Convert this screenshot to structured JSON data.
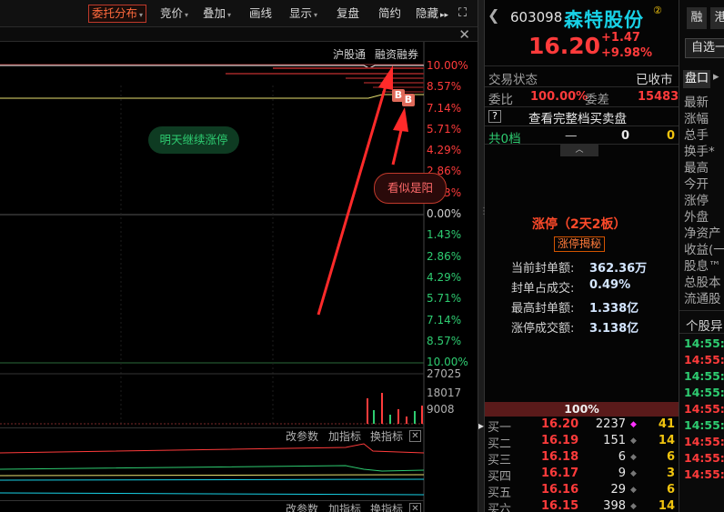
{
  "toolbar": {
    "items": [
      "委托分布",
      "竞价",
      "叠加",
      "画线",
      "显示",
      "复盘",
      "简约",
      "隐藏"
    ],
    "caret": "▾",
    "hide_arrow": "▸▸",
    "expand_icon": "⛶",
    "close_icon": "✕"
  },
  "chart": {
    "hud_links": [
      "沪股通",
      "融资融券"
    ],
    "pct_up": [
      "10.00%",
      "8.57%",
      "7.14%",
      "5.71%",
      "4.29%",
      "2.86%",
      "1.43%"
    ],
    "pct_zero": "0.00%",
    "pct_down": [
      "1.43%",
      "2.86%",
      "4.29%",
      "5.71%",
      "7.14%",
      "8.57%",
      "10.00%"
    ],
    "note1": "明天继续涨停",
    "note2": "看似是阳",
    "b_mark": "B",
    "volume_labels": [
      "27025",
      "18017",
      "9008"
    ],
    "indicator_links": [
      "改参数",
      "加指标",
      "换指标"
    ],
    "indicator_close": "✕",
    "colors": {
      "up": "#ff3b3b",
      "down": "#2ecc71",
      "price_line": "#e8e070",
      "arrow": "#ff2a2a"
    }
  },
  "quote": {
    "code": "603098",
    "name": "森特股份",
    "name_badge": "②",
    "price": "16.20",
    "change": "+1.47",
    "change_pct": "+9.98%",
    "trade_status_label": "交易状态",
    "trade_status": "已收市",
    "weibi_label": "委比",
    "weibi": "100.00%",
    "weicha_label": "委差",
    "weicha": "15483",
    "help_icon": "?",
    "full_book": "查看完整档买卖盘",
    "total_label": "共0档",
    "total_dash": "—",
    "total_v1": "0",
    "total_v2": "0",
    "expand_chevron": "︿",
    "limit_title": "涨停（2天2板）",
    "limit_button": "涨停揭秘",
    "stats": [
      {
        "label": "当前封单额:",
        "value": "362.36万"
      },
      {
        "label": "封单占成交:",
        "value": "0.49%"
      },
      {
        "label": "最高封单额:",
        "value": "1.338亿"
      },
      {
        "label": "涨停成交额:",
        "value": "3.138亿"
      }
    ],
    "ratio": "100%",
    "bids": [
      {
        "label": "买一",
        "price": "16.20",
        "vol": "2237",
        "diamond": "◆",
        "count": "41"
      },
      {
        "label": "买二",
        "price": "16.19",
        "vol": "151",
        "diamond": "◆",
        "count": "14"
      },
      {
        "label": "买三",
        "price": "16.18",
        "vol": "6",
        "diamond": "◆",
        "count": "6"
      },
      {
        "label": "买四",
        "price": "16.17",
        "vol": "9",
        "diamond": "◆",
        "count": "3"
      },
      {
        "label": "买五",
        "price": "16.16",
        "vol": "29",
        "diamond": "◆",
        "count": "6"
      },
      {
        "label": "买六",
        "price": "16.15",
        "vol": "398",
        "diamond": "◆",
        "count": "14"
      }
    ]
  },
  "strip": {
    "btn1": "融",
    "btn2": "港",
    "zixuan": "自选一",
    "tab_pankou": "盘口",
    "tab_more": "▸",
    "fields": [
      "最新",
      "涨幅",
      "总手",
      "换手*",
      "最高",
      "今开",
      "涨停",
      "外盘",
      "净资产",
      "收益(一)",
      "股息™",
      "总股本",
      "流通股"
    ],
    "ggt_label": "个股异",
    "ticks": [
      "14:55:1",
      "14:55:1",
      "14:55:1",
      "14:55:3",
      "14:55:3",
      "14:55:3",
      "14:55:4",
      "14:55:4",
      "14:55:5"
    ]
  }
}
